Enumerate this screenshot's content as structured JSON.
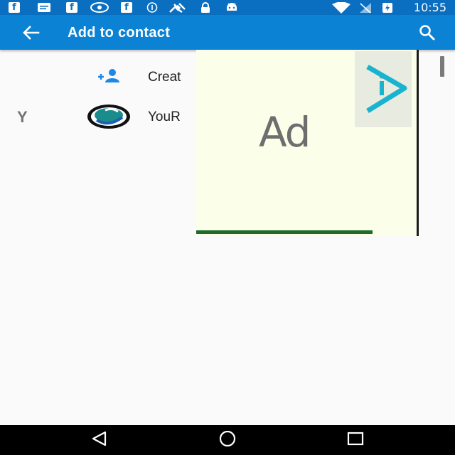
{
  "status_bar": {
    "time": "10:55",
    "icons": [
      "facebook-icon",
      "message-icon",
      "facebook-icon",
      "eye-icon",
      "facebook-icon",
      "info-circle-icon",
      "satellite-icon",
      "lock-icon",
      "android-icon",
      "wifi-icon",
      "no-sim-icon",
      "battery-charging-icon"
    ]
  },
  "app_bar": {
    "title": "Add to contact",
    "back_icon": "back-arrow-icon",
    "search_icon": "search-icon"
  },
  "list": {
    "create_row": {
      "icon": "add-person-icon",
      "label": "Creat"
    },
    "section_letter": "Y",
    "contact_row": {
      "icon": "contact-avatar-icon",
      "label": "YouR"
    }
  },
  "ad": {
    "text": "Ad",
    "badge_icon": "play-badge-icon"
  },
  "nav_bar": {
    "back": "nav-back-icon",
    "home": "nav-home-icon",
    "recents": "nav-recents-icon"
  },
  "colors": {
    "status_bar": "#0a6fc0",
    "app_bar": "#0b82d3",
    "accent": "#1e88e5",
    "ad_bg": "#fbffe9",
    "ad_badge_accent": "#19b3d0"
  }
}
